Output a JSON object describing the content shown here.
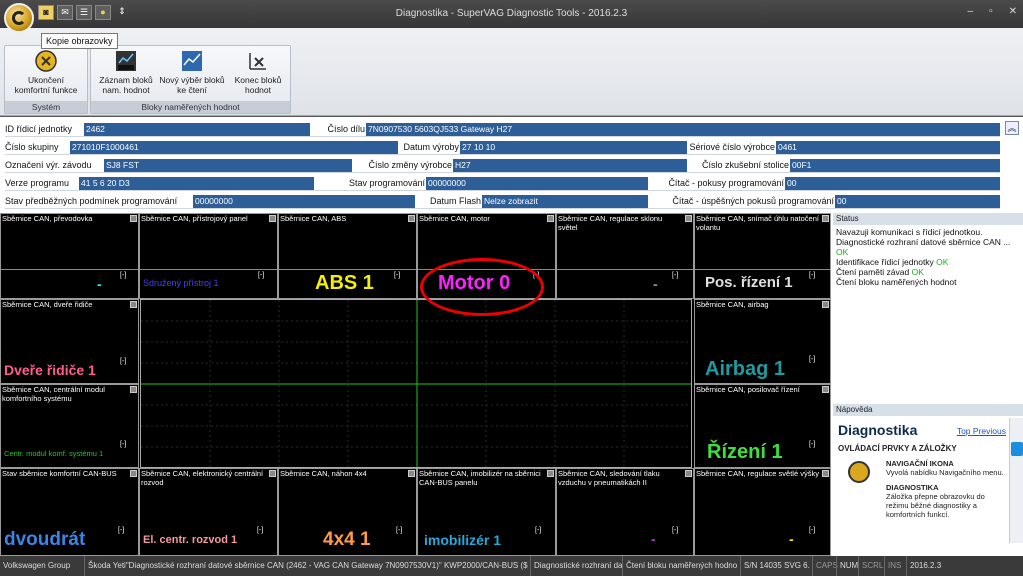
{
  "window": {
    "title": "Diagnostika - SuperVAG Diagnostic Tools - 2016.2.3",
    "min": "–",
    "restore": "▫",
    "close": "✕"
  },
  "qat": {
    "icons": [
      "camera-icon",
      "mail-icon",
      "list-icon",
      "bulb-icon"
    ],
    "dropdown": "⇕"
  },
  "tooltip": "Kopie obrazovky",
  "ribbon": {
    "groups": [
      {
        "label": "Systém",
        "buttons": [
          {
            "label": "Ukončení komfortní funkce",
            "icon": "exit-comfort-icon"
          }
        ]
      },
      {
        "label": "Bloky naměřených hodnot",
        "buttons": [
          {
            "label": "Záznam bloků nam. hodnot",
            "icon": "rec-icon"
          },
          {
            "label": "Nový výběr bloků ke čtení",
            "icon": "chart-select-icon"
          },
          {
            "label": "Konec bloků hodnot",
            "icon": "end-blocks-icon"
          }
        ]
      }
    ]
  },
  "info": {
    "rows": [
      [
        {
          "l": "ID řídicí jednotky",
          "v": "2462"
        },
        {
          "l": "Číslo dílu",
          "v": "7N0907530    5603QJ533  Gateway    H27"
        }
      ],
      [
        {
          "l": "Číslo skupiny",
          "v": "271010F1000461"
        },
        {
          "l": "Datum výroby",
          "v": "27 10 10"
        },
        {
          "l": "Sériové číslo výrobce",
          "v": "0461"
        }
      ],
      [
        {
          "l": "Označení výr. závodu",
          "v": "SJ8 FST"
        },
        {
          "l": "Číslo změny výrobce",
          "v": "H27"
        },
        {
          "l": "Číslo zkušební stolice",
          "v": "00F1"
        }
      ],
      [
        {
          "l": "Verze programu",
          "v": "41 5 6  20  D3"
        },
        {
          "l": "Stav programování",
          "v": "00000000"
        },
        {
          "l": "Čítač - pokusy programování",
          "v": "00"
        }
      ],
      [
        {
          "l": "Stav předběžných podmínek programování",
          "v": "00000000"
        },
        {
          "l": "Datum Flash",
          "v": "Nelze zobrazit"
        },
        {
          "l": "Čítač - úspěšných pokusů programování",
          "v": "00"
        }
      ]
    ],
    "collapse": "︽"
  },
  "cells": {
    "c1": {
      "name": "Sběrnice CAN, převodovka",
      "value": "-"
    },
    "c2": {
      "name": "Sběrnice CAN, přístrojový panel",
      "value": "Sdružený přístroj 1"
    },
    "c3": {
      "name": "Sběrnice CAN, ABS",
      "value": "ABS 1"
    },
    "c4": {
      "name": "Sběrnice CAN, motor",
      "value": "Motor 0"
    },
    "c5": {
      "name": "Sběrnice CAN, regulace sklonu světel",
      "value": "-"
    },
    "c6": {
      "name": "Sběrnice CAN, snímač úhlu natočení volantu",
      "value": "Pos. řízení 1"
    },
    "c7": {
      "name": "Sběrnice CAN, dveře řidiče",
      "value": "Dveře řidiče 1"
    },
    "c8": {
      "name": "Sběrnice CAN, airbag",
      "value": "Airbag 1"
    },
    "c9": {
      "name": "Sběrnice CAN, centrální modul komfortního systému",
      "value": "Centr. modul komf. systému 1"
    },
    "c10": {
      "name": "Sběrnice CAN, posilovač řízení",
      "value": "Řízení 1"
    },
    "c11": {
      "name": "Stav sběrnice komfortní CAN-BUS",
      "value": "dvoudrát"
    },
    "c12": {
      "name": "Sběrnice CAN, elektronický centrální rozvod",
      "value": "El. centr. rozvod 1"
    },
    "c13": {
      "name": "Sběrnice CAN, náhon 4x4",
      "value": "4x4 1"
    },
    "c14": {
      "name": "Sběrnice CAN, imobilizér na sběrnici CAN-BUS panelu",
      "value": "imobilizér 1"
    },
    "c15": {
      "name": "Sběrnice CAN, sledování tlaku vzduchu v pneumatikách II",
      "value": "-"
    },
    "c16": {
      "name": "Sběrnice CAN, regulace světlé výšky",
      "value": "-"
    },
    "bracket": "[-]"
  },
  "status": {
    "title": "Status",
    "line1": "Navazuji komunikaci s řídicí jednotkou.",
    "line2": "Diagnostické rozhraní datové sběrnice CAN ... ",
    "ok": "OK",
    "line3": "Identifikace řídicí jednotky ",
    "line4": "Čtení paměti závad ",
    "line5": "Čtení bloku naměřených hodnot"
  },
  "help": {
    "title": "Nápověda",
    "heading": "Diagnostika",
    "top": "Top",
    "previous": "Previous",
    "section": "OVLÁDACÍ PRVKY A ZÁLOŽKY",
    "item1_title": "NAVIGAČNÍ IKONA",
    "item1_text": "Vyvolá nabídku Navigačního menu.",
    "item2_title": "DIAGNOSTIKA",
    "item2_text": "Záložka přepne obrazovku do režimu běžné diagnostiky a komfortních funkcí."
  },
  "statusbar": {
    "s1": "Volkswagen Group",
    "s2": "Škoda Yeti\"Diagnostické rozhraní datové sběrnice CAN (2462 - VAG CAN Gateway 7N0907530V1)\" KWP2000/CAN-BUS ($CB)",
    "s3": "Diagnostické rozhraní da",
    "s4": "Čtení bloku naměřených hodno",
    "s5": "S/N 14035 SVG 6.",
    "s6": "CAPS",
    "s7": "NUM",
    "s8": "SCRL",
    "s9": "INS",
    "s10": "2016.2.3"
  },
  "colors": {
    "c3": "#f4f000",
    "c4": "#ff20ff",
    "c6": "#e0e0e0",
    "c7": "#ff5f8c",
    "c8": "#1e9aa0",
    "c9": "#28c428",
    "c10": "#3ee03e",
    "c11": "#3a86e8",
    "c12": "#f49a9a",
    "c13": "#ff9a48",
    "c14": "#2aa8d8",
    "c2": "#4040ff"
  }
}
